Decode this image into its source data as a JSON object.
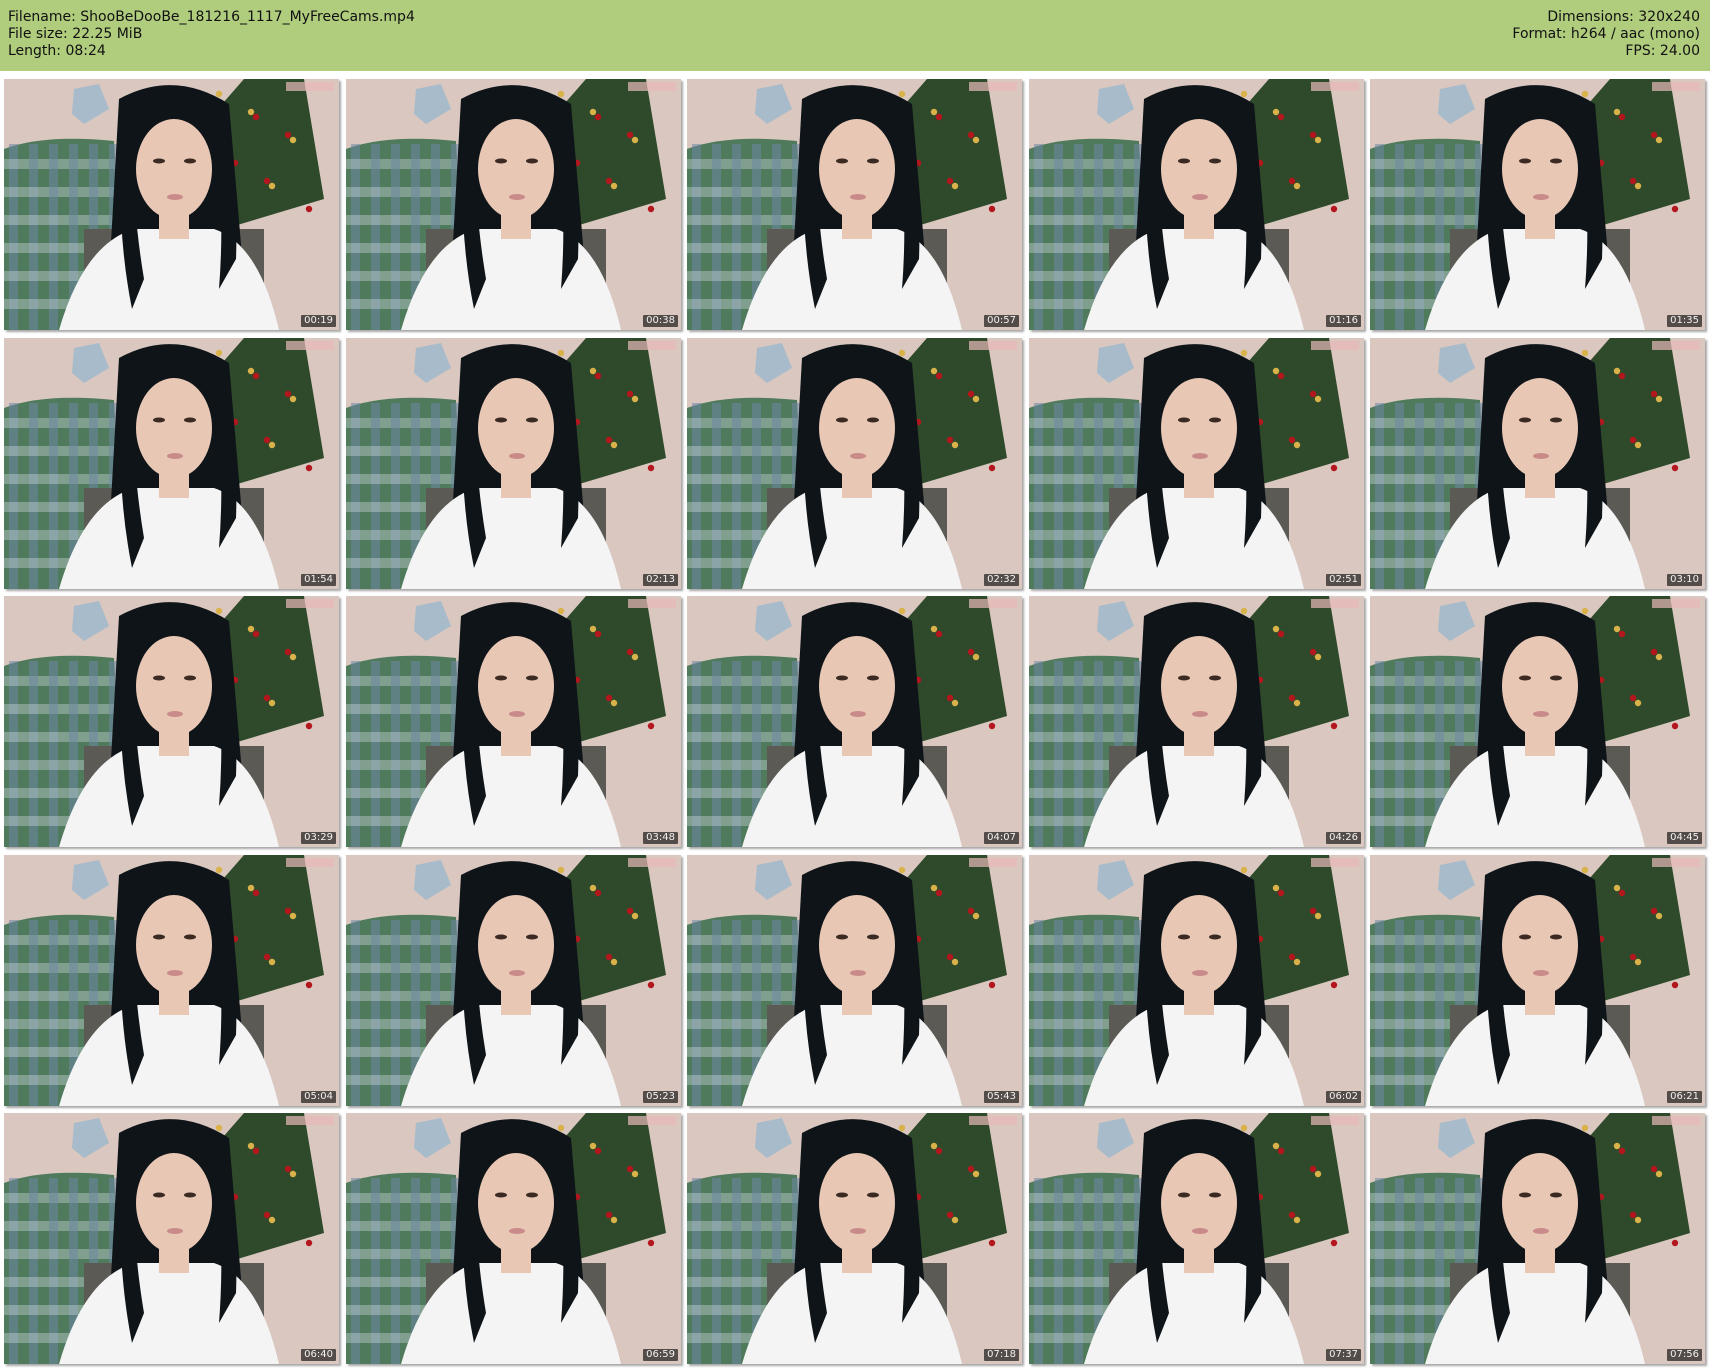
{
  "header": {
    "filename": "Filename: ShooBeDooBe_181216_1117_MyFreeCams.mp4",
    "file_size": "File size: 22.25 MiB",
    "length": "Length: 08:24",
    "dimensions": "Dimensions: 320x240",
    "format": "Format: h264 / aac (mono)",
    "fps": "FPS: 24.00"
  },
  "colors": {
    "header_bg": "#b0cc7d",
    "wall": "#d9c7c0",
    "blanket_green": "#4f7a5c",
    "blanket_blue": "#6e86a6",
    "tree": "#2f4a2a",
    "hair": "#0e1418",
    "skin": "#e8c7b5",
    "shirt": "#f4f4f4"
  },
  "thumbnails": [
    {
      "timestamp": "00:19"
    },
    {
      "timestamp": "00:38"
    },
    {
      "timestamp": "00:57"
    },
    {
      "timestamp": "01:16"
    },
    {
      "timestamp": "01:35"
    },
    {
      "timestamp": "01:54"
    },
    {
      "timestamp": "02:13"
    },
    {
      "timestamp": "02:32"
    },
    {
      "timestamp": "02:51"
    },
    {
      "timestamp": "03:10"
    },
    {
      "timestamp": "03:29"
    },
    {
      "timestamp": "03:48"
    },
    {
      "timestamp": "04:07"
    },
    {
      "timestamp": "04:26"
    },
    {
      "timestamp": "04:45"
    },
    {
      "timestamp": "05:04"
    },
    {
      "timestamp": "05:23"
    },
    {
      "timestamp": "05:43"
    },
    {
      "timestamp": "06:02"
    },
    {
      "timestamp": "06:21"
    },
    {
      "timestamp": "06:40"
    },
    {
      "timestamp": "06:59"
    },
    {
      "timestamp": "07:18"
    },
    {
      "timestamp": "07:37"
    },
    {
      "timestamp": "07:56"
    }
  ]
}
